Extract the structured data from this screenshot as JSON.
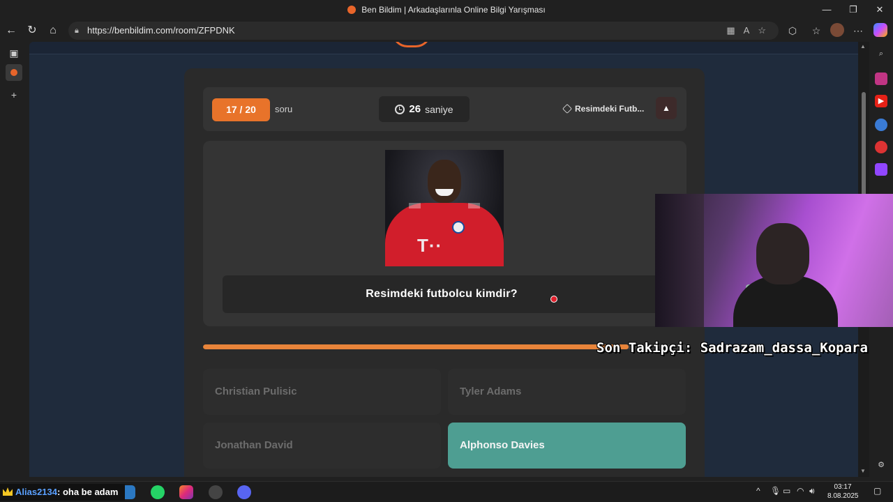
{
  "window": {
    "title": "Ben Bildim | Arkadaşlarınla Online Bilgi Yarışması",
    "controls": [
      "—",
      "❐",
      "✕"
    ]
  },
  "browser": {
    "url": "https://benbildim.com/room/ZFPDNK",
    "nav_icons": [
      "back-icon",
      "refresh-icon",
      "home-icon"
    ],
    "toolbar_icons": [
      "split-screen-icon",
      "read-aloud-icon",
      "favorite-star-icon",
      "extensions-icon",
      "favorites-icon",
      "profile-avatar",
      "more-icon",
      "copilot-icon"
    ]
  },
  "quiz": {
    "question_counter": "17 / 20",
    "question_word": "soru",
    "timer_value": "26",
    "timer_unit": "saniye",
    "category": "Resimdeki Futb...",
    "warning_glyph": "▲",
    "question": "Resimdeki futbolcu kimdir?",
    "time_progress": 0.88,
    "answers": [
      {
        "label": "Christian Pulisic",
        "state": "wrong"
      },
      {
        "label": "Tyler Adams",
        "state": "wrong"
      },
      {
        "label": "Jonathan David",
        "state": "wrong"
      },
      {
        "label": "Alphonso Davies",
        "state": "correct"
      }
    ]
  },
  "overlay": {
    "last_follower": "Son Takipçi: Sadrazam_dassa_Kopara",
    "chat_user": "Alias2134",
    "chat_message": ": oha be adam"
  },
  "taskbar": {
    "time": "03:17",
    "date": "8.08.2025",
    "tray_icons": [
      "chevron-up-icon",
      "mic-icon",
      "battery-icon",
      "wifi-icon",
      "volume-icon",
      "notification-icon"
    ]
  },
  "colors": {
    "accent": "#e8732a",
    "correct": "#4e9e92",
    "page_bg": "#1f2b3c",
    "card_bg": "#2a2a2a"
  }
}
